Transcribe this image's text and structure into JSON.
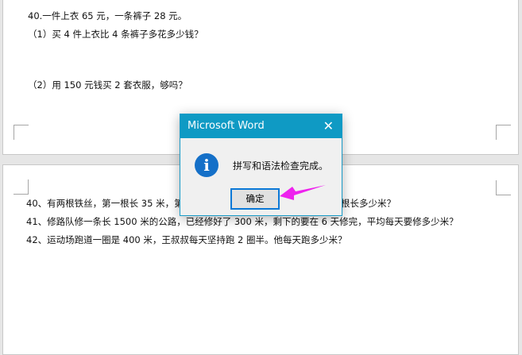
{
  "document": {
    "page1": [
      "40.一件上衣 65 元，一条裤子 28 元。",
      "（1）买 4 件上衣比 4 条裤子多花多少钱？",
      "（2）用 150 元钱买 2 套衣服，够吗？"
    ],
    "page2": {
      "line40_start": "40、有两根铁丝，第一根长 35 米，第",
      "line40_end": "根长多少米？",
      "line41": "41、修路队修一条长 1500 米的公路，已经修好了 300 米，剩下的要在 6 天修完，平均每天要修多少米？",
      "line42": "42、运动场跑道一圈是 400 米，王叔叔每天坚持跑 2 圈半。他每天跑多少米？"
    }
  },
  "dialog": {
    "title": "Microsoft Word",
    "close": "✕",
    "icon": "i",
    "message": "拼写和语法检查完成。",
    "ok_label": "确定"
  },
  "colors": {
    "title_bar": "#0f9ac4",
    "arrow": "#ee22ee"
  }
}
